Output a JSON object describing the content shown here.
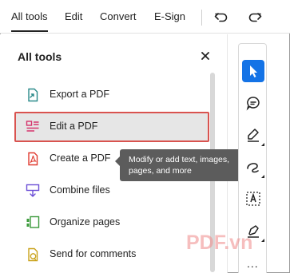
{
  "menu": {
    "items": [
      {
        "label": "All tools",
        "active": true
      },
      {
        "label": "Edit"
      },
      {
        "label": "Convert"
      },
      {
        "label": "E-Sign"
      }
    ],
    "undo_icon": "undo-icon",
    "redo_icon": "redo-icon"
  },
  "panel": {
    "title": "All tools",
    "close_icon": "close-icon",
    "tools": [
      {
        "label": "Export a PDF",
        "icon": "export-pdf-icon",
        "color": "#2b8a8a"
      },
      {
        "label": "Edit a PDF",
        "icon": "edit-pdf-icon",
        "color": "#d6336c",
        "selected": true
      },
      {
        "label": "Create a PDF",
        "icon": "create-pdf-icon",
        "color": "#e03c31"
      },
      {
        "label": "Combine files",
        "icon": "combine-files-icon",
        "color": "#6c4fd6"
      },
      {
        "label": "Organize pages",
        "icon": "organize-pages-icon",
        "color": "#3a9a3a"
      },
      {
        "label": "Send for comments",
        "icon": "send-for-comments-icon",
        "color": "#c9a21a"
      }
    ]
  },
  "tooltip": {
    "text": "Modify or add text, images, pages, and more"
  },
  "right_toolbar": {
    "tools": [
      "select-cursor-icon",
      "comment-icon",
      "highlight-pen-icon",
      "draw-freehand-icon",
      "text-select-icon",
      "sign-icon"
    ],
    "more": "..."
  },
  "colors": {
    "accent": "#1473e6",
    "selection_border": "#d9534f",
    "tooltip_bg": "#5c5c5c"
  },
  "watermark": "PDF.vn"
}
